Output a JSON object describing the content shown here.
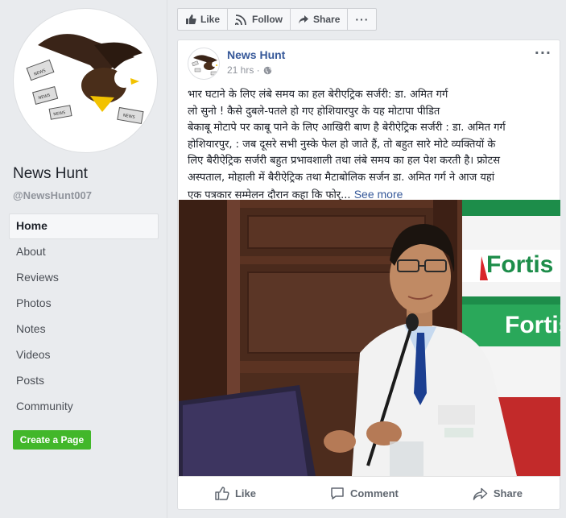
{
  "page": {
    "name": "News Hunt",
    "handle": "@NewsHunt007"
  },
  "nav": [
    {
      "label": "Home",
      "active": true
    },
    {
      "label": "About"
    },
    {
      "label": "Reviews"
    },
    {
      "label": "Photos"
    },
    {
      "label": "Notes"
    },
    {
      "label": "Videos"
    },
    {
      "label": "Posts"
    },
    {
      "label": "Community"
    }
  ],
  "create_page_label": "Create a Page",
  "action_bar": {
    "like": "Like",
    "follow": "Follow",
    "share": "Share",
    "more": "···"
  },
  "post": {
    "author": "News Hunt",
    "time": "21 hrs ·",
    "more": "···",
    "lines": [
      "भार घटाने के लिए लंबे समय का हल बेरीएट्रिक सर्जरी: डा. अमित गर्ग",
      "लो सुनो ! कैसे दुबले-पतले हो गए होशियारपुर के यह मोटापा पीडित",
      "बेकाबू मोटापे पर काबू पाने के लिए आखिरी बाण है बेरीऐट्रिक सर्जरी : डा. अमित गर्ग",
      "होशियारपुर, : जब दूसरे सभी नुस्के फेल हो जाते हैं, तो बहुत सारे मोटे व्यक्तियों के",
      "लिए बैरीऐट्रिक सर्जरी बहुत प्रभावशाली तथा लंबे समय का हल पेश करती है। फ्रोटस",
      "अस्पताल, मोहाली में बैरीऐट्रिक तथा मैटाबोलिक सर्जन डा. अमित गर्ग ने आज यहां"
    ],
    "last_line": "एक पत्रकार सम्मेलन दौरान कहा कि फोर्...",
    "see_more": "See more"
  },
  "photo": {
    "banner_text_1": "Fortis",
    "banner_text_2": "Fortis"
  },
  "reactions": {
    "like": "Like",
    "comment": "Comment",
    "share": "Share"
  },
  "colors": {
    "link": "#365899",
    "green": "#42b72a",
    "background": "#e9ebee"
  }
}
